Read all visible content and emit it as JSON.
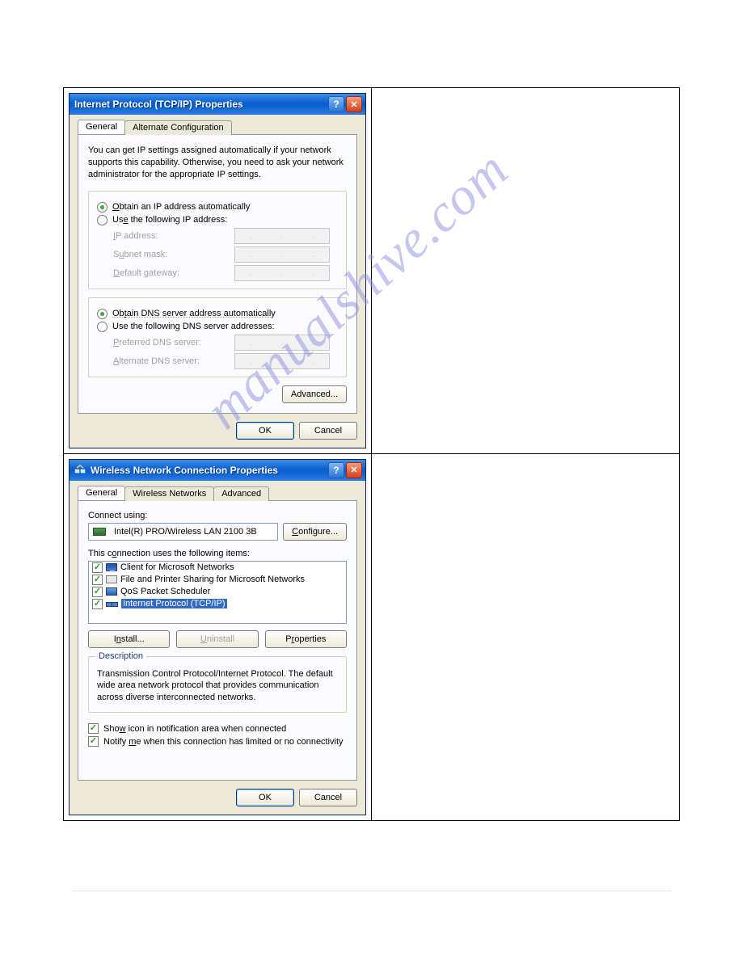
{
  "watermark": "manualshive.com",
  "tcpip": {
    "title": "Internet Protocol (TCP/IP) Properties",
    "tabs": {
      "general": "General",
      "alt": "Alternate Configuration"
    },
    "desc": "You can get IP settings assigned automatically if your network supports this capability. Otherwise, you need to ask your network administrator for the appropriate IP settings.",
    "radio_auto_ip_pre": "O",
    "radio_auto_ip": "btain an IP address automatically",
    "radio_use_ip_pre": "Us",
    "radio_use_ip": "e the following IP address:",
    "lbl_ip_pre": "I",
    "lbl_ip": "P address:",
    "lbl_mask_pre": "S",
    "lbl_mask": "ubnet mask:",
    "lbl_gw_pre": "D",
    "lbl_gw": "efault gateway:",
    "radio_auto_dns_pre": "Ob",
    "radio_auto_dns": "tain DNS server address automatically",
    "radio_use_dns_pre": "Use",
    "radio_use_dns": " the following DNS server addresses:",
    "lbl_pdns_pre": "P",
    "lbl_pdns": "referred DNS server:",
    "lbl_adns_pre": "A",
    "lbl_adns": "lternate DNS server:",
    "btn_advanced": "Advanced...",
    "btn_ok": "OK",
    "btn_cancel": "Cancel"
  },
  "wlan": {
    "title": "Wireless Network Connection Properties",
    "tabs": {
      "general": "General",
      "wireless": "Wireless Networks",
      "advanced": "Advanced"
    },
    "connect_using": "Connect using:",
    "adapter": "Intel(R) PRO/Wireless LAN 2100 3B",
    "btn_configure": "Configure...",
    "items_label_pre": "This c",
    "items_label_und": "o",
    "items_label_post": "nnection uses the following items:",
    "items": {
      "client": "Client for Microsoft Networks",
      "fps": "File and Printer Sharing for Microsoft Networks",
      "qos": "QoS Packet Scheduler",
      "tcpip": "Internet Protocol (TCP/IP)"
    },
    "btn_install": "Install...",
    "btn_uninstall": "Uninstall",
    "btn_properties": "Properties",
    "desc_title": "Description",
    "desc_text": "Transmission Control Protocol/Internet Protocol. The default wide area network protocol that provides communication across diverse interconnected networks.",
    "chk_showicon_pre": "Sho",
    "chk_showicon_und": "w",
    "chk_showicon_post": " icon in notification area when connected",
    "chk_notify_pre": "Notify ",
    "chk_notify_und": "m",
    "chk_notify_post": "e when this connection has limited or no connectivity",
    "btn_ok": "OK",
    "btn_cancel": "Cancel"
  }
}
